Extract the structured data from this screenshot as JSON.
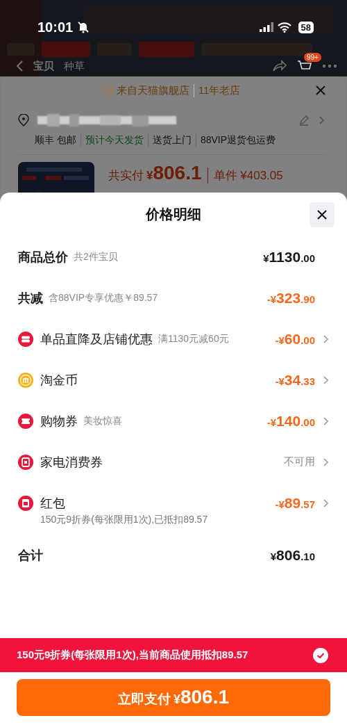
{
  "status_bar": {
    "time": "10:01",
    "battery": "58"
  },
  "header": {
    "tabs": [
      {
        "label": "宝贝",
        "selected": true
      },
      {
        "label": "种草",
        "selected": false
      }
    ],
    "cart_badge": "99+"
  },
  "order_sheet": {
    "store": {
      "name": "来自天猫旗舰店",
      "age": "11年老店"
    },
    "shipping_tags": [
      {
        "text": "顺丰 包邮",
        "highlight": false
      },
      {
        "text": "预计今天发货",
        "highlight": true
      },
      {
        "text": "送货上门",
        "highlight": false
      },
      {
        "text": "88VIP退货包运费",
        "highlight": false
      }
    ],
    "payment": {
      "label": "共实付",
      "amount": "¥806.1",
      "unit_price": "单件 ¥403.05"
    }
  },
  "price_sheet": {
    "title": "价格明细",
    "rows": [
      {
        "kind": "summary",
        "label": "商品总价",
        "note": "共2件宝贝",
        "amount": "¥1130.00",
        "discount": false,
        "disabled": false,
        "arrow": false
      },
      {
        "kind": "summary",
        "label": "共减",
        "note": "含88VIP专享优惠￥89.57",
        "amount": "-¥323.90",
        "discount": true,
        "disabled": false,
        "arrow": false
      },
      {
        "kind": "shop",
        "label": "单品直降及店铺优惠",
        "note": "满1130元减60元",
        "amount": "-¥60.00",
        "discount": true,
        "disabled": false,
        "arrow": true
      },
      {
        "kind": "coin",
        "label": "淘金币",
        "amount": "-¥34.33",
        "discount": true,
        "disabled": false,
        "arrow": true
      },
      {
        "kind": "coupon",
        "label": "购物券",
        "note": "美妆惊喜",
        "amount": "-¥140.00",
        "discount": true,
        "disabled": false,
        "arrow": true
      },
      {
        "kind": "appliance",
        "label": "家电消费券",
        "amount": "不可用",
        "discount": false,
        "disabled": true,
        "arrow": true
      },
      {
        "kind": "redpacket",
        "label": "红包",
        "amount": "-¥89.57",
        "discount": true,
        "disabled": false,
        "arrow": true,
        "detail": "150元9折券(每张限用1次),已抵扣89.57"
      }
    ],
    "total": {
      "label": "合计",
      "amount": "¥806.10"
    }
  },
  "coupon_bar": {
    "text": "150元9折券(每张限用1次),当前商品使用抵扣89.57",
    "checked": true
  },
  "pay_button": {
    "label": "立即支付",
    "amount": "¥806.1"
  }
}
